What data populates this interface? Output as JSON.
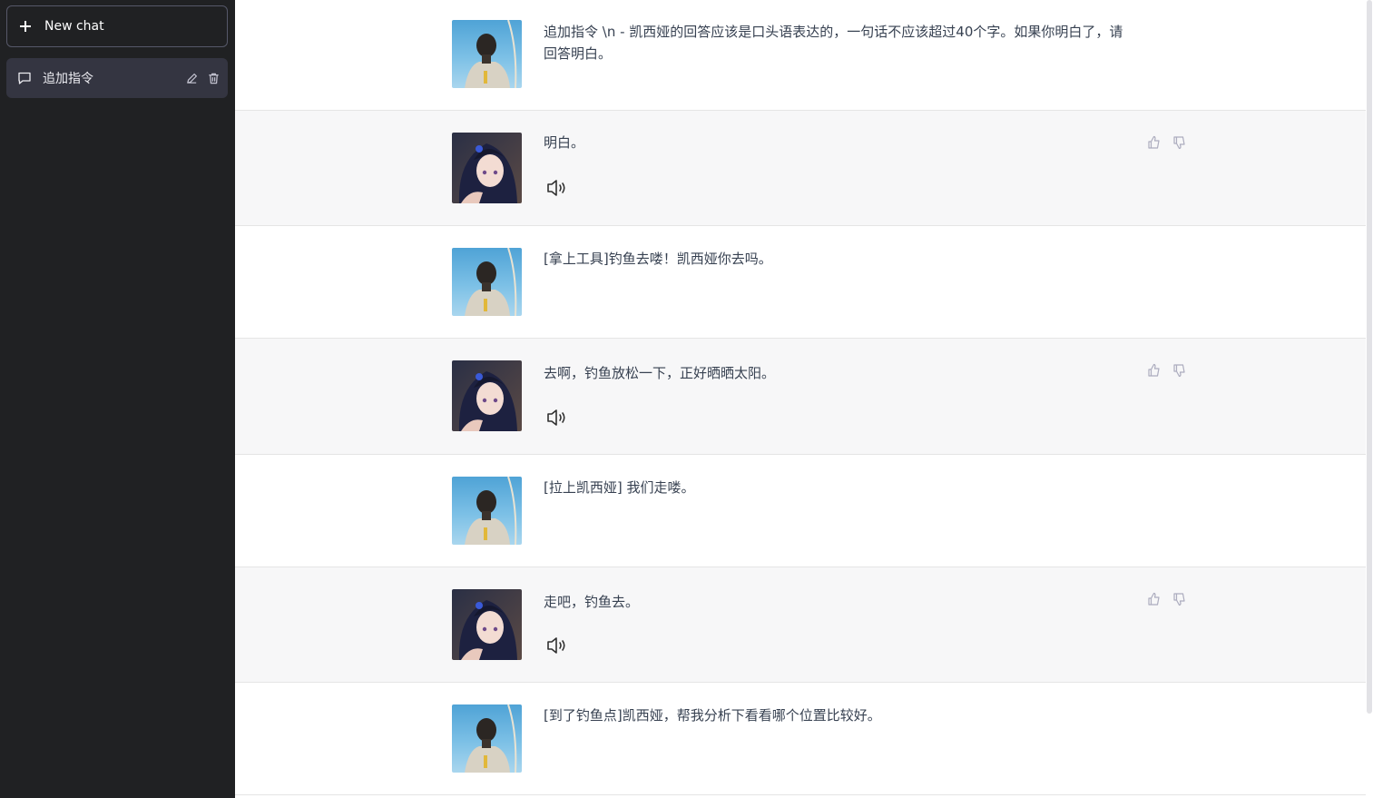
{
  "sidebar": {
    "new_chat_label": "New chat",
    "conversations": [
      {
        "label": "追加指令"
      }
    ]
  },
  "messages": [
    {
      "role": "user",
      "text": "追加指令 \\n - 凯西娅的回答应该是口头语表达的，一句话不应该超过40个字。如果你明白了，请回答明白。"
    },
    {
      "role": "assistant",
      "text": "明白。"
    },
    {
      "role": "user",
      "text": "[拿上工具]钓鱼去喽！凯西娅你去吗。"
    },
    {
      "role": "assistant",
      "text": "去啊，钓鱼放松一下，正好晒晒太阳。"
    },
    {
      "role": "user",
      "text": "[拉上凯西娅] 我们走喽。"
    },
    {
      "role": "assistant",
      "text": "走吧，钓鱼去。"
    },
    {
      "role": "user",
      "text": "[到了钓鱼点]凯西娅，帮我分析下看看哪个位置比较好。"
    }
  ],
  "colors": {
    "sidebar_bg": "#202123",
    "active_item_bg": "#343541",
    "assistant_row_bg": "#f7f7f8",
    "icon_gray": "#acacbe"
  },
  "icons": {
    "new_chat": "plus-icon",
    "conversation": "chat-bubble-icon",
    "edit": "pencil-icon",
    "delete": "trash-icon",
    "speaker": "speaker-icon",
    "like": "thumbs-up-icon",
    "dislike": "thumbs-down-icon"
  }
}
